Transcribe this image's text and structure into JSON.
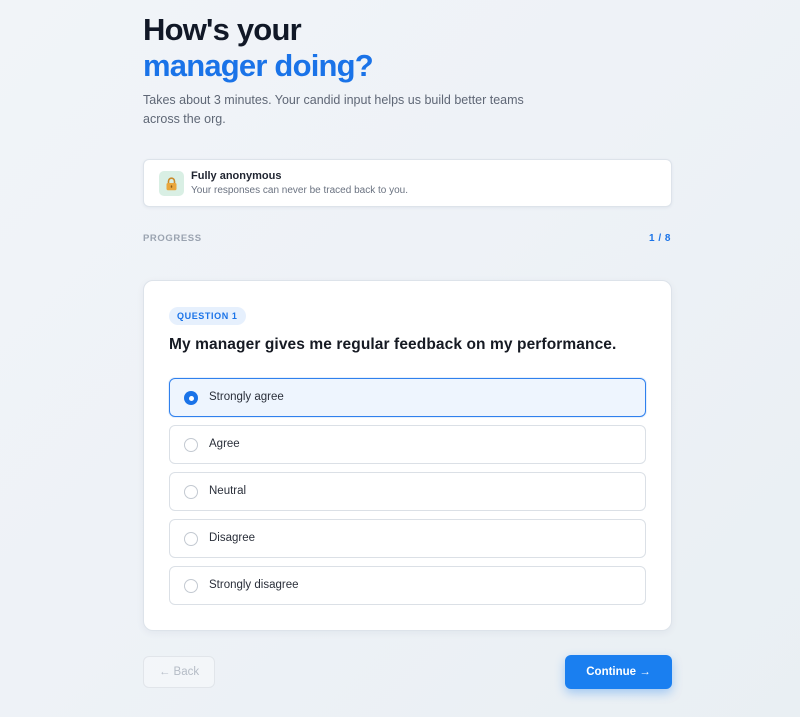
{
  "header": {
    "title_line1": "How's your",
    "title_line2": "manager doing?",
    "subtitle": "Takes about 3 minutes. Your candid input helps us build better teams across the org."
  },
  "anonymity": {
    "icon": "lock-icon",
    "title": "Fully anonymous",
    "description": "Your responses can never be traced back to you."
  },
  "progress": {
    "label": "PROGRESS",
    "count": "1 / 8",
    "current": 1,
    "total": 8
  },
  "question": {
    "badge": "QUESTION 1",
    "text": "My manager gives me regular feedback on my performance.",
    "selected_index": 0,
    "options": [
      {
        "label": "Strongly agree"
      },
      {
        "label": "Agree"
      },
      {
        "label": "Neutral"
      },
      {
        "label": "Disagree"
      },
      {
        "label": "Strongly disagree"
      }
    ]
  },
  "nav": {
    "back_label": "← Back",
    "continue_label": "Continue →"
  },
  "colors": {
    "accent": "#1a73e8",
    "selected_bg": "#eef5fe",
    "lock_bg": "#d9efe4"
  }
}
